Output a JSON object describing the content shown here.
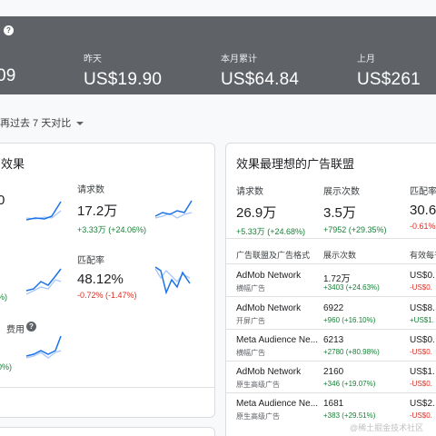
{
  "banner": {
    "today_value_partial": "09",
    "yesterday": {
      "label": "昨天",
      "value": "US$19.90"
    },
    "month": {
      "label": "本月累计",
      "value": "US$64.84"
    },
    "last_month": {
      "label": "上月",
      "value": "US$261"
    }
  },
  "compare": {
    "label": "再过去 7 天对比"
  },
  "left_card": {
    "title_partial": "效果",
    "requests": {
      "label": "请求数",
      "value": "17.2万",
      "delta": "+3.33万 (+24.06%)"
    },
    "match_rate": {
      "label": "匹配率",
      "value": "48.12%",
      "delta": "-0.72% (-1.47%)"
    },
    "left_value_partial": "0",
    "left_delta_partial": "%)",
    "left_delta_partial_2": "0%)",
    "fee_label_partial": "费用"
  },
  "right_card": {
    "title": "效果最理想的广告联盟",
    "requests": {
      "label": "请求数",
      "value": "26.9万",
      "delta": "+5.33万 (+24.68%)"
    },
    "impressions": {
      "label": "展示次数",
      "value": "3.5万",
      "delta": "+7952 (+29.35%)"
    },
    "match_rate": {
      "label": "匹配率",
      "value": "30.6",
      "delta": "-0.61% ("
    },
    "table": {
      "headers": [
        "广告联盟及广告格式",
        "展示次数",
        "有效每千"
      ],
      "rows": [
        {
          "name": "AdMob Network",
          "format": "横幅广告",
          "impressions": "1.72万",
          "delta": "+3403 (+24.63%)",
          "ecpm": "US$0.",
          "ecpm_delta": "-US$0."
        },
        {
          "name": "AdMob Network",
          "format": "开屏广告",
          "impressions": "6922",
          "delta": "+960 (+16.10%)",
          "ecpm": "US$8.",
          "ecpm_delta": "+US$1."
        },
        {
          "name": "Meta Audience Ne...",
          "format": "横幅广告",
          "impressions": "6213",
          "delta": "+2780 (+80.98%)",
          "ecpm": "US$0.",
          "ecpm_delta": "-US$0."
        },
        {
          "name": "AdMob Network",
          "format": "原生高级广告",
          "impressions": "2160",
          "delta": "+346 (+19.07%)",
          "ecpm": "US$1.",
          "ecpm_delta": "-US$0."
        },
        {
          "name": "Meta Audience Ne...",
          "format": "原生高级广告",
          "impressions": "1681",
          "delta": "+383 (+29.51%)",
          "ecpm": "US$2.",
          "ecpm_delta": "-US$0."
        }
      ]
    }
  },
  "watermark": "@稀土掘金技术社区",
  "colors": {
    "banner": "#5f6368",
    "positive": "#188038",
    "negative": "#d93025",
    "spark_primary": "#1a73e8",
    "spark_secondary": "#a8c7fa"
  }
}
